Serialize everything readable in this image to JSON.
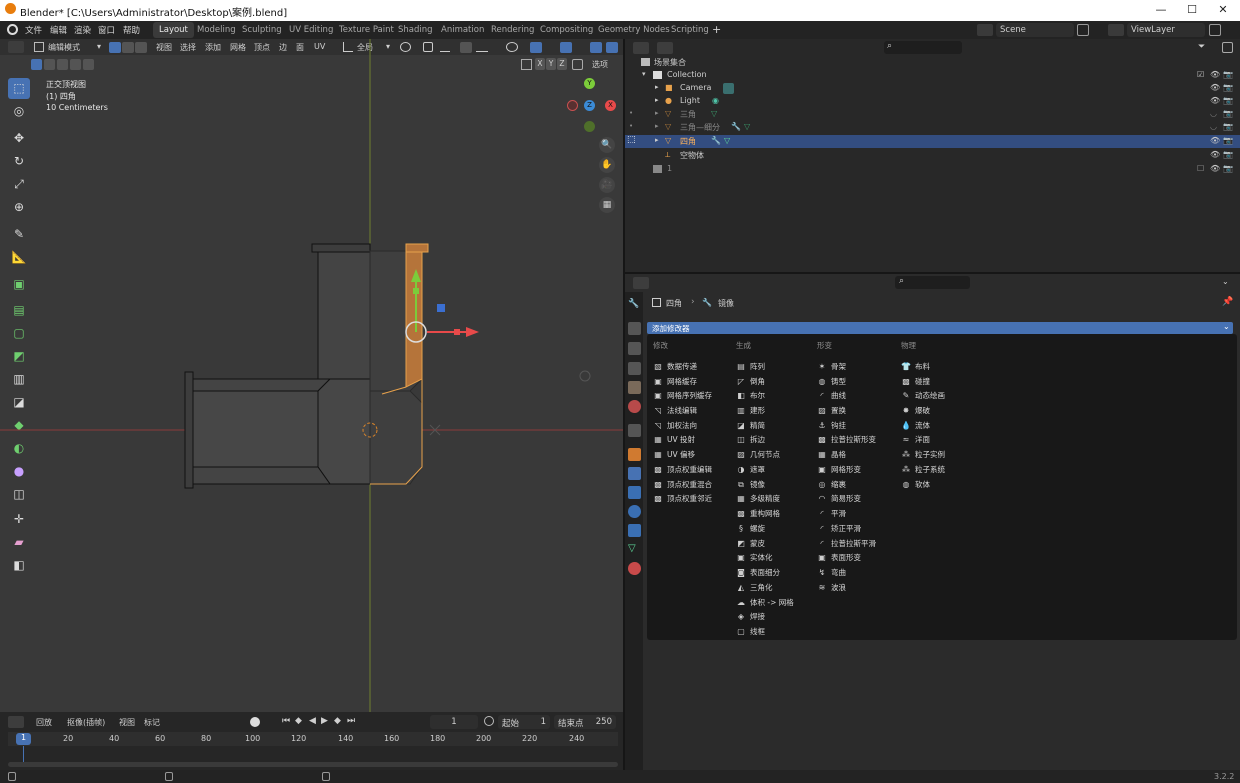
{
  "window": {
    "title": "Blender* [C:\\Users\\Administrator\\Desktop\\案例.blend]",
    "minimize": "—",
    "maximize": "☐",
    "close": "✕"
  },
  "topbar": {
    "menus": [
      "文件",
      "编辑",
      "渲染",
      "窗口",
      "帮助"
    ],
    "workspaces": [
      "Layout",
      "Modeling",
      "Sculpting",
      "UV Editing",
      "Texture Paint",
      "Shading",
      "Animation",
      "Rendering",
      "Compositing",
      "Geometry Nodes",
      "Scripting"
    ],
    "active_workspace": "Layout",
    "add_workspace": "+",
    "scene": "Scene",
    "view_layer": "ViewLayer"
  },
  "viewport": {
    "mode": "编辑模式",
    "header_menus": [
      "视图",
      "选择",
      "添加",
      "网格",
      "顶点",
      "边",
      "面",
      "UV"
    ],
    "transform": "全局",
    "axes": [
      "X",
      "Y",
      "Z"
    ],
    "options": "选项",
    "view_name": "正交顶视图",
    "object_name": "(1) 四角",
    "scale": "10 Centimeters",
    "gizmo": {
      "x": "X",
      "y": "Y",
      "z": "Z"
    },
    "accent": "#4772b3",
    "selection_color": "#e8a24c"
  },
  "timeline": {
    "menus": [
      "回放",
      "抠像(插帧)",
      "视图",
      "标记"
    ],
    "current_frame": "1",
    "start_label": "起始",
    "start": "1",
    "end_label": "结束点",
    "end": "250",
    "ruler": [
      "1",
      "20",
      "40",
      "60",
      "80",
      "100",
      "120",
      "140",
      "160",
      "180",
      "200",
      "220",
      "240"
    ]
  },
  "outliner": {
    "root": "场景集合",
    "rows": [
      {
        "name": "Collection",
        "icon": "collection-icon",
        "indent": 1
      },
      {
        "name": "Camera",
        "icon": "camera-icon",
        "indent": 2
      },
      {
        "name": "Light",
        "icon": "light-icon",
        "indent": 2
      },
      {
        "name": "三角",
        "icon": "mesh-icon",
        "indent": 2
      },
      {
        "name": "三角—细分",
        "icon": "mesh-icon",
        "indent": 2
      },
      {
        "name": "四角",
        "icon": "mesh-icon",
        "indent": 2,
        "selected": true
      },
      {
        "name": "空物体",
        "icon": "empty-icon",
        "indent": 2
      },
      {
        "name": "1",
        "icon": "collection-icon",
        "indent": 1
      }
    ]
  },
  "properties": {
    "breadcrumb_object": "四角",
    "breadcrumb_sep": "›",
    "breadcrumb_modifier": "镜像",
    "add_modifier": "添加修改器",
    "columns": [
      {
        "header": "修改",
        "items": [
          "数据传递",
          "网格缓存",
          "网格序列缓存",
          "法线编辑",
          "加权法向",
          "UV 投射",
          "UV 偏移",
          "顶点权重编辑",
          "顶点权重混合",
          "顶点权重邻近"
        ]
      },
      {
        "header": "生成",
        "items": [
          "阵列",
          "倒角",
          "布尔",
          "建形",
          "精简",
          "拆边",
          "几何节点",
          "遮罩",
          "镜像",
          "多级精度",
          "重构网格",
          "螺旋",
          "蒙皮",
          "实体化",
          "表面细分",
          "三角化",
          "体积 -> 网格",
          "焊接",
          "线框"
        ]
      },
      {
        "header": "形变",
        "items": [
          "骨架",
          "铸型",
          "曲线",
          "置换",
          "钩挂",
          "拉普拉斯形变",
          "晶格",
          "网格形变",
          "缩裹",
          "简易形变",
          "平滑",
          "矫正平滑",
          "拉普拉斯平滑",
          "表面形变",
          "弯曲",
          "波浪"
        ]
      },
      {
        "header": "物理",
        "items": [
          "布料",
          "碰撞",
          "动态绘画",
          "爆破",
          "流体",
          "洋面",
          "粒子实例",
          "粒子系统",
          "软体"
        ]
      }
    ]
  },
  "statusbar": {
    "version": "3.2.2"
  }
}
